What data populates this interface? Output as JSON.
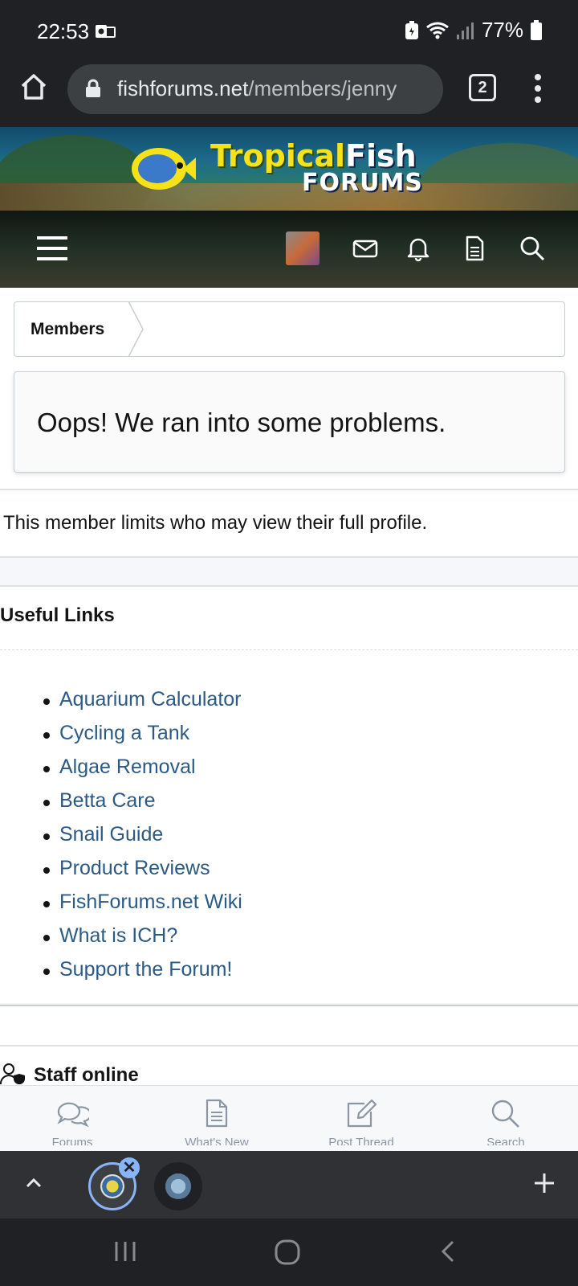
{
  "status_bar": {
    "time": "22:53",
    "battery": "77%"
  },
  "browser": {
    "url_host": "fishforums.net",
    "url_path": "/members/jenny",
    "tab_count": "2"
  },
  "site": {
    "logo_line1": "Tropical",
    "logo_line1_b": "Fish",
    "logo_line2": "FORUMS"
  },
  "nav_icons": [
    "menu-icon",
    "avatar",
    "mail-icon",
    "bell-icon",
    "document-icon",
    "search-icon"
  ],
  "breadcrumb": {
    "item": "Members"
  },
  "notice": {
    "title": "Oops! We ran into some problems."
  },
  "profile": {
    "message": "This member limits who may view their full profile."
  },
  "useful_links": {
    "title": "Useful Links",
    "items": [
      "Aquarium Calculator",
      "Cycling a Tank",
      "Algae Removal",
      "Betta Care",
      "Snail Guide",
      "Product Reviews",
      "FishForums.net Wiki",
      "What is ICH?",
      "Support the Forum!"
    ]
  },
  "staff_online": {
    "title": "Staff online"
  },
  "bottom_tabs": [
    {
      "label": "Forums",
      "icon": "chat-icon"
    },
    {
      "label": "What's New",
      "icon": "document-icon"
    },
    {
      "label": "Post Thread",
      "icon": "compose-icon"
    },
    {
      "label": "Search",
      "icon": "search-icon"
    }
  ],
  "colors": {
    "link": "#2b5a85",
    "chrome": "#202124",
    "accent": "#8ab4f8"
  }
}
